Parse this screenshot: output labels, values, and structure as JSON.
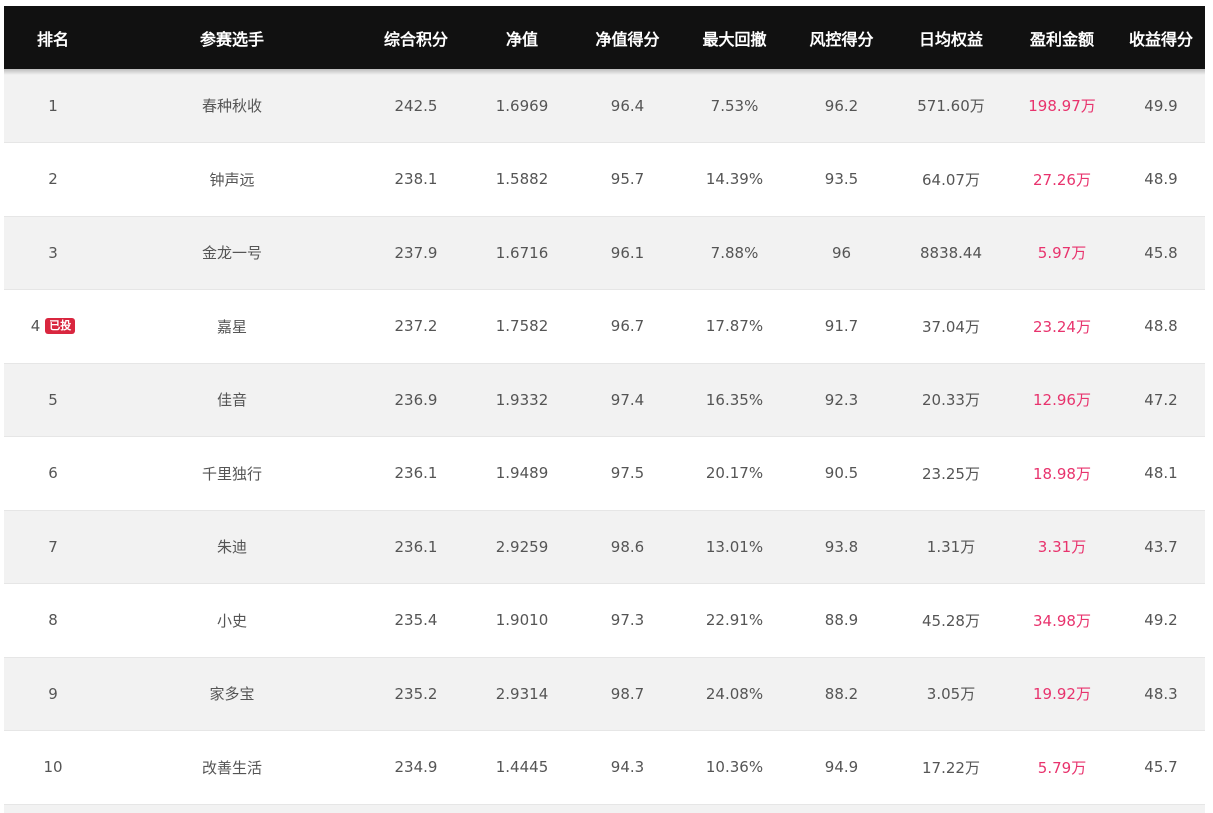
{
  "table": {
    "headers": [
      "排名",
      "参赛选手",
      "综合积分",
      "净值",
      "净值得分",
      "最大回撤",
      "风控得分",
      "日均权益",
      "盈利金额",
      "收益得分"
    ],
    "badge_text": "已投",
    "rows": [
      {
        "rank": "1",
        "badge": "",
        "name": "春种秋收",
        "score": "242.5",
        "nav": "1.6969",
        "nav_score": "96.4",
        "max_drawdown": "7.53%",
        "risk_score": "96.2",
        "daily_equity": "571.60万",
        "profit": "198.97万",
        "return_score": "49.9"
      },
      {
        "rank": "2",
        "badge": "",
        "name": "钟声远",
        "score": "238.1",
        "nav": "1.5882",
        "nav_score": "95.7",
        "max_drawdown": "14.39%",
        "risk_score": "93.5",
        "daily_equity": "64.07万",
        "profit": "27.26万",
        "return_score": "48.9"
      },
      {
        "rank": "3",
        "badge": "",
        "name": "金龙一号",
        "score": "237.9",
        "nav": "1.6716",
        "nav_score": "96.1",
        "max_drawdown": "7.88%",
        "risk_score": "96",
        "daily_equity": "8838.44",
        "profit": "5.97万",
        "return_score": "45.8"
      },
      {
        "rank": "4",
        "badge": "已投",
        "name": "嘉星",
        "score": "237.2",
        "nav": "1.7582",
        "nav_score": "96.7",
        "max_drawdown": "17.87%",
        "risk_score": "91.7",
        "daily_equity": "37.04万",
        "profit": "23.24万",
        "return_score": "48.8"
      },
      {
        "rank": "5",
        "badge": "",
        "name": "佳音",
        "score": "236.9",
        "nav": "1.9332",
        "nav_score": "97.4",
        "max_drawdown": "16.35%",
        "risk_score": "92.3",
        "daily_equity": "20.33万",
        "profit": "12.96万",
        "return_score": "47.2"
      },
      {
        "rank": "6",
        "badge": "",
        "name": "千里独行",
        "score": "236.1",
        "nav": "1.9489",
        "nav_score": "97.5",
        "max_drawdown": "20.17%",
        "risk_score": "90.5",
        "daily_equity": "23.25万",
        "profit": "18.98万",
        "return_score": "48.1"
      },
      {
        "rank": "7",
        "badge": "",
        "name": "朱迪",
        "score": "236.1",
        "nav": "2.9259",
        "nav_score": "98.6",
        "max_drawdown": "13.01%",
        "risk_score": "93.8",
        "daily_equity": "1.31万",
        "profit": "3.31万",
        "return_score": "43.7"
      },
      {
        "rank": "8",
        "badge": "",
        "name": "小史",
        "score": "235.4",
        "nav": "1.9010",
        "nav_score": "97.3",
        "max_drawdown": "22.91%",
        "risk_score": "88.9",
        "daily_equity": "45.28万",
        "profit": "34.98万",
        "return_score": "49.2"
      },
      {
        "rank": "9",
        "badge": "",
        "name": "家多宝",
        "score": "235.2",
        "nav": "2.9314",
        "nav_score": "98.7",
        "max_drawdown": "24.08%",
        "risk_score": "88.2",
        "daily_equity": "3.05万",
        "profit": "19.92万",
        "return_score": "48.3"
      },
      {
        "rank": "10",
        "badge": "",
        "name": "改善生活",
        "score": "234.9",
        "nav": "1.4445",
        "nav_score": "94.3",
        "max_drawdown": "10.36%",
        "risk_score": "94.9",
        "daily_equity": "17.22万",
        "profit": "5.79万",
        "return_score": "45.7"
      }
    ]
  },
  "colors": {
    "header_bg": "#111111",
    "row_alt_bg": "#f2f2f2",
    "profit_text": "#e8336d",
    "badge_bg": "#d9263f"
  }
}
